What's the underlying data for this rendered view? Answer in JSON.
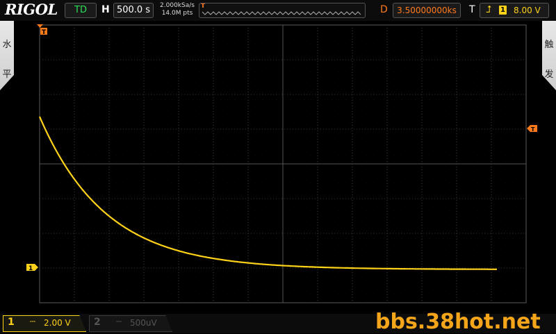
{
  "brand": "RIGOL",
  "top_bar": {
    "run_state": "TD",
    "horizontal_label": "H",
    "timebase": "500.0 s",
    "sample_rate": "2.000kSa/s",
    "memory_depth": "14.0M pts",
    "delay_label": "D",
    "delay_value": "3.50000000ks",
    "trigger_label": "T",
    "trigger_source": "1",
    "trigger_level": "8.00 V"
  },
  "side_tabs": {
    "left": [
      "水",
      "平"
    ],
    "right": [
      "触",
      "发"
    ]
  },
  "channels": [
    {
      "number": "1",
      "coupling": "⎓",
      "scale": "2.00 V",
      "active": true
    },
    {
      "number": "2",
      "coupling": "⎓",
      "scale": "500uV",
      "active": false
    }
  ],
  "watermark": "bbs.38hot.net",
  "colors": {
    "ch1": "#ffd21a",
    "trigger": "#ff7a1a",
    "run_state": "#2ee05a",
    "grid": "#3c3c3c"
  },
  "waveform": {
    "shape": "exponential decay",
    "channel": "1"
  }
}
